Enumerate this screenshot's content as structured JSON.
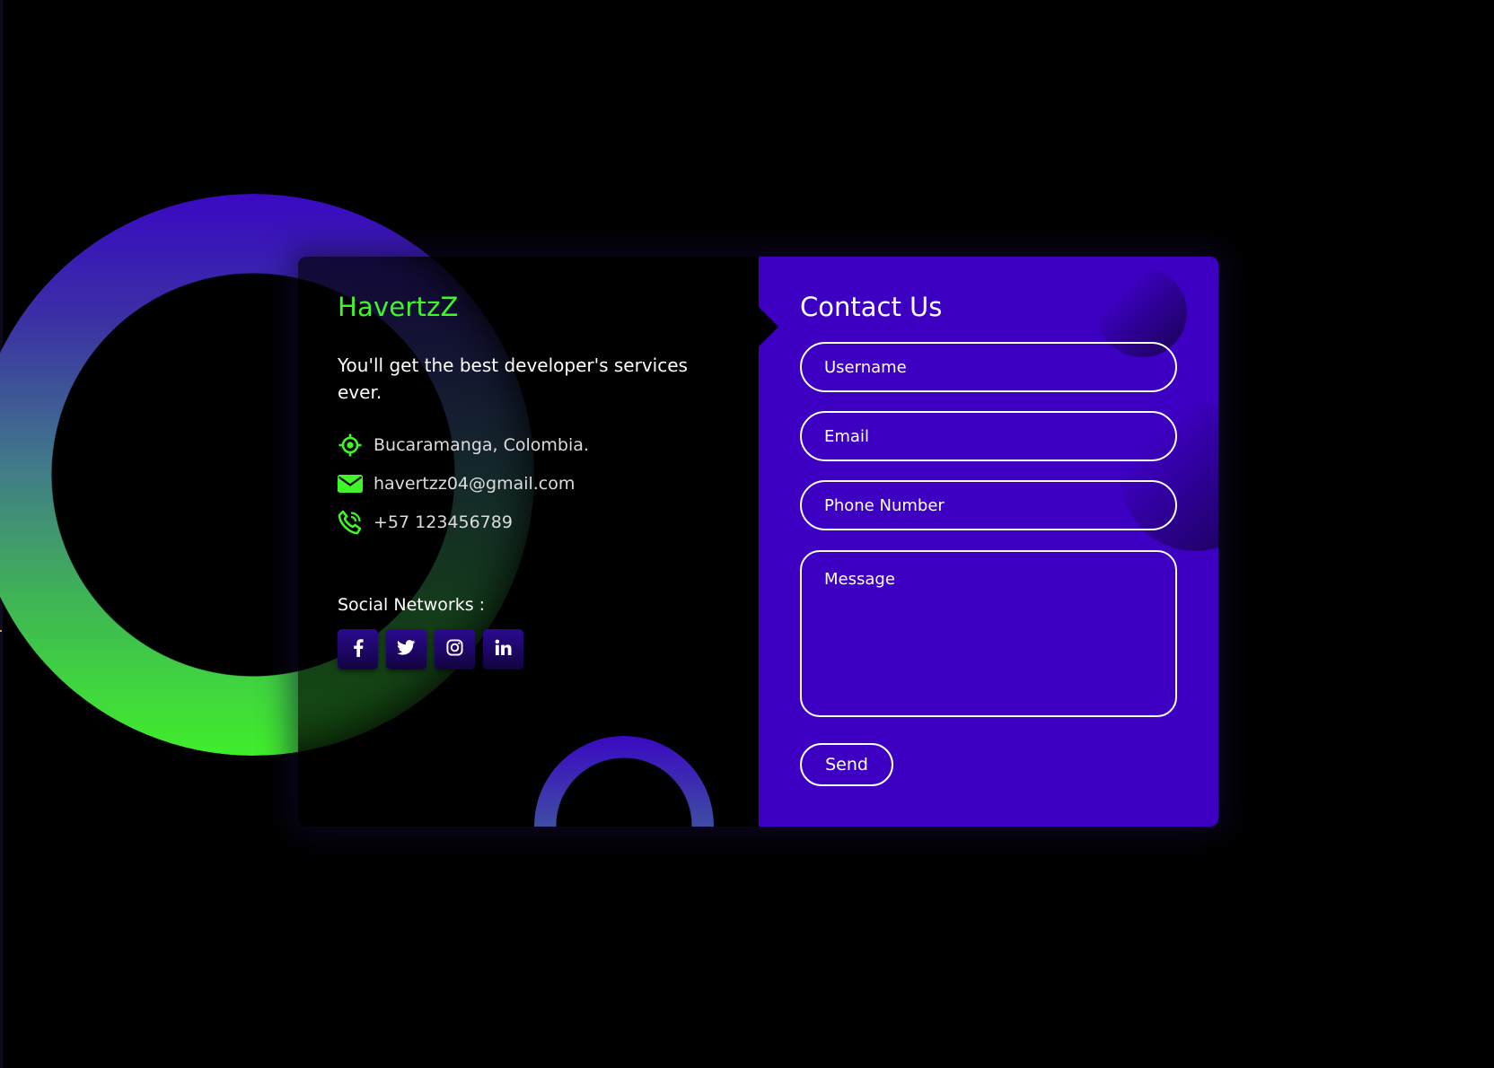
{
  "colors": {
    "background": "#000000",
    "brand_green": "#40f62b",
    "form_panel": "#3d00c3",
    "social_button": "#1b065f",
    "text_light": "#ffffff",
    "ring_top": "#3a09c2",
    "ring_bottom": "#40ee2c"
  },
  "contact_info": {
    "brand": "HavertzZ",
    "tagline": "You'll get the best developer's services ever.",
    "items": [
      {
        "icon": "location-crosshair-icon",
        "text": "Bucaramanga, Colombia."
      },
      {
        "icon": "envelope-icon",
        "text": "havertzz04@gmail.com"
      },
      {
        "icon": "phone-call-icon",
        "text": "+57 123456789"
      }
    ],
    "social_title": "Social Networks :",
    "social_links": [
      {
        "icon": "facebook-icon",
        "label": "f"
      },
      {
        "icon": "twitter-icon",
        "label": "twitter"
      },
      {
        "icon": "instagram-icon",
        "label": "instagram"
      },
      {
        "icon": "linkedin-icon",
        "label": "in"
      }
    ]
  },
  "contact_form": {
    "title": "Contact Us",
    "fields": {
      "username": "Username",
      "email": "Email",
      "phone": "Phone Number",
      "message": "Message"
    },
    "send_label": "Send"
  }
}
